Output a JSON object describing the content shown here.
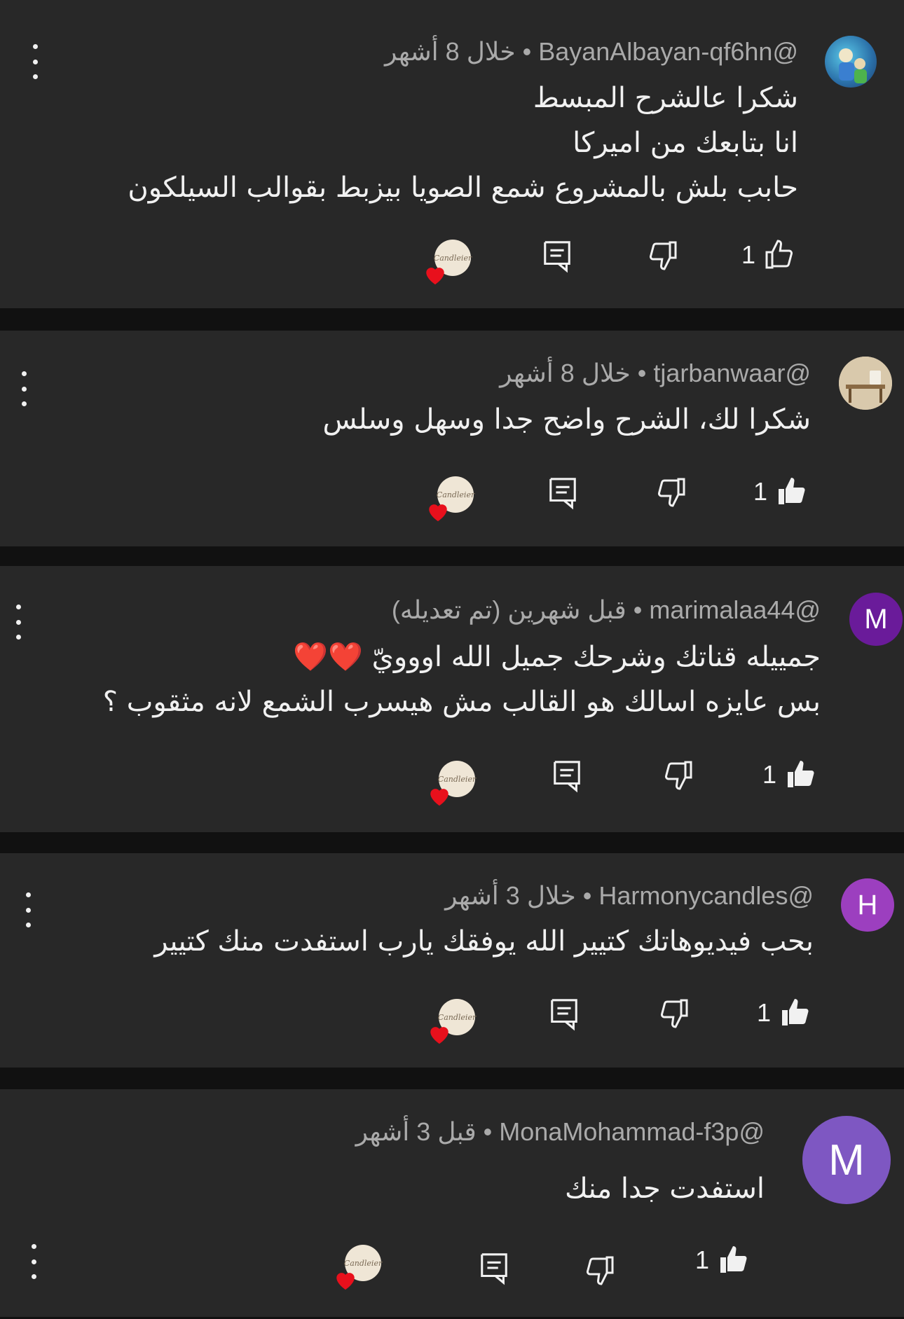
{
  "comments": [
    {
      "handle": "@BayanAlbayan-qf6hn",
      "time": "خلال 8 أشهر",
      "lines": [
        "شكرا عالشرح المبسط",
        "انا بتابعك من اميركا",
        "حابب بلش بالمشروع شمع الصويا بيزبط بقوالب السيلكون"
      ],
      "likes": "1",
      "avatar_type": "photo-blue"
    },
    {
      "handle": "@tjarbanwaar",
      "time": "خلال 8 أشهر",
      "lines": [
        "شكرا لك، الشرح واضح جدا وسهل وسلس"
      ],
      "likes": "1",
      "avatar_type": "photo-room"
    },
    {
      "handle": "@marimalaa44",
      "time": "قبل شهرين (تم تعديله)",
      "lines": [
        "جمييله قناتك وشرحك جميل الله اووويّ ❤️❤️",
        "بس عايزه اسالك هو القالب مش هيسرب الشمع لانه مثقوب ؟"
      ],
      "likes": "1",
      "avatar_letter": "M",
      "avatar_color": "#6a1b9a"
    },
    {
      "handle": "@Harmonycandles",
      "time": "خلال 3 أشهر",
      "lines": [
        "بحب فيديوهاتك كتيير الله يوفقك يارب استفدت منك كتيير"
      ],
      "likes": "1",
      "avatar_letter": "H",
      "avatar_color": "#9c3fbf"
    },
    {
      "handle": "@MonaMohammad-f3p",
      "time": "قبل 3 أشهر",
      "lines": [
        "استفدت جدا منك"
      ],
      "likes": "1",
      "avatar_letter": "M",
      "avatar_color": "#7e57c2"
    }
  ],
  "creator_badge_text": "Candleier",
  "separator": "•",
  "colors": {
    "card_bg": "#282828",
    "page_bg": "#111111",
    "heart": "#e8101c",
    "meta_text": "#aaaaaa"
  }
}
